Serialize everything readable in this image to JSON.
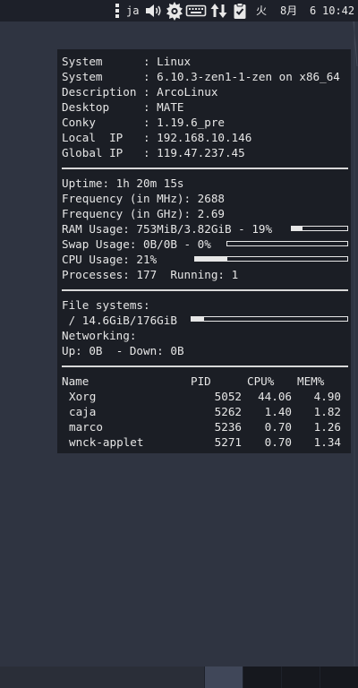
{
  "top_panel": {
    "input_method": "ja",
    "day_of_week": "火",
    "month": "8月",
    "day": "6",
    "time": "10:42"
  },
  "conky": {
    "system_info": [
      {
        "label": "System     ",
        "value": "Linux"
      },
      {
        "label": "System     ",
        "value": "6.10.3-zen1-1-zen on x86_64"
      },
      {
        "label": "Description",
        "value": "ArcoLinux"
      },
      {
        "label": "Desktop    ",
        "value": "MATE"
      },
      {
        "label": "Conky      ",
        "value": "1.19.6_pre"
      },
      {
        "label": "Local  IP  ",
        "value": "192.168.10.146"
      },
      {
        "label": "Global IP  ",
        "value": "119.47.237.45"
      }
    ],
    "uptime_label": "Uptime:",
    "uptime": "1h 20m 15s",
    "freq_mhz_label": "Frequency (in MHz):",
    "freq_mhz": "2688",
    "freq_ghz_label": "Frequency (in GHz):",
    "freq_ghz": "2.69",
    "ram_label": "RAM Usage:",
    "ram_value": "753MiB/3.82GiB - 19%",
    "ram_fraction": 0.19,
    "swap_label": "Swap Usage:",
    "swap_value": "0B/0B - 0%",
    "swap_fraction": 0.0,
    "cpu_label": "CPU Usage:",
    "cpu_value": "21%",
    "cpu_fraction": 0.21,
    "processes_label": "Processes:",
    "processes": "177",
    "running_label": "Running:",
    "running": "1",
    "filesystems_label": "File systems:",
    "fs_mount": "/",
    "fs_value": "14.6GiB/176GiB",
    "fs_fraction": 0.083,
    "networking_label": "Networking:",
    "up_label": "Up:",
    "up_value": "0B",
    "down_label": "- Down:",
    "down_value": "0B",
    "proc_headers": {
      "name": "Name",
      "pid": "PID",
      "cpu": "CPU%",
      "mem": "MEM%"
    },
    "processes_list": [
      {
        "name": "Xorg",
        "pid": "5052",
        "cpu": "44.06",
        "mem": "4.90"
      },
      {
        "name": "caja",
        "pid": "5262",
        "cpu": "1.40",
        "mem": "1.82"
      },
      {
        "name": "marco",
        "pid": "5236",
        "cpu": "0.70",
        "mem": "1.26"
      },
      {
        "name": "wnck-applet",
        "pid": "5271",
        "cpu": "0.70",
        "mem": "1.34"
      }
    ]
  }
}
